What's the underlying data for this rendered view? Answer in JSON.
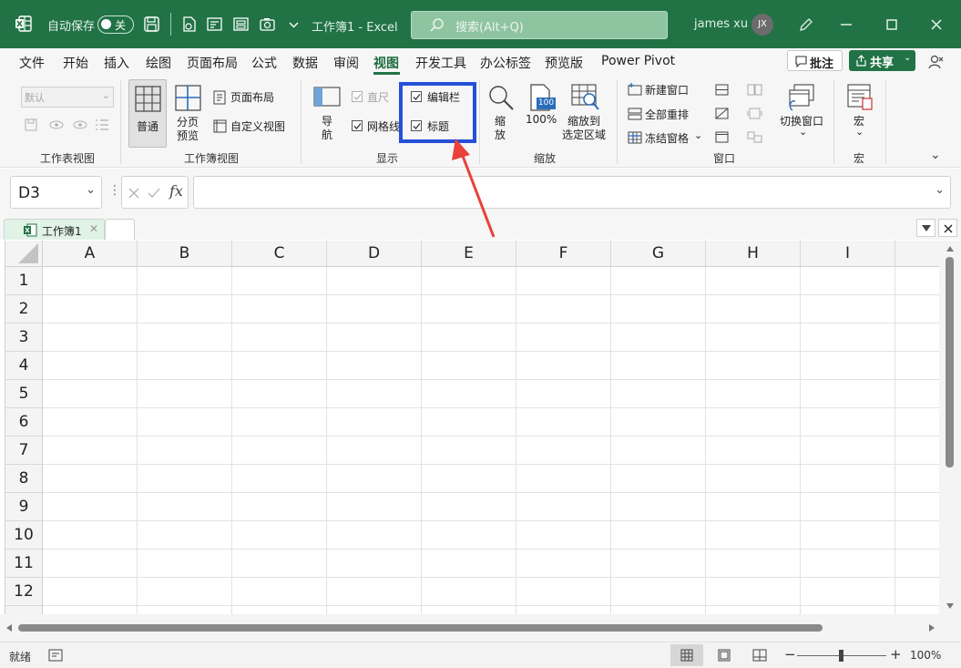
{
  "titlebar": {
    "autosave_label": "自动保存",
    "autosave_state": "关",
    "doc_title": "工作簿1  -  Excel",
    "search_placeholder": "搜索(Alt+Q)",
    "user_name": "james xu",
    "user_initials": "JX"
  },
  "menu": {
    "items": [
      "文件",
      "开始",
      "插入",
      "绘图",
      "页面布局",
      "公式",
      "数据",
      "审阅",
      "视图",
      "开发工具",
      "办公标签",
      "预览版",
      "Power Pivot"
    ],
    "active": "视图",
    "comments_label": "批注",
    "share_label": "共享"
  },
  "ribbon": {
    "sheet_view": {
      "dropdown_value": "默认",
      "group_label": "工作表视图"
    },
    "workbook_views": {
      "normal": "普通",
      "page_break_1": "分页",
      "page_break_2": "预览",
      "page_layout": "页面布局",
      "custom_views": "自定义视图",
      "group_label": "工作簿视图"
    },
    "show": {
      "navigation_1": "导",
      "navigation_2": "航",
      "ruler": "直尺",
      "gridlines": "网格线",
      "formula_bar": "编辑栏",
      "headings": "标题",
      "group_label": "显示"
    },
    "zoom": {
      "zoom_1": "缩",
      "zoom_2": "放",
      "hundred": "100%",
      "hundred_icon_text": "100",
      "zoom_to_selection_1": "缩放到",
      "zoom_to_selection_2": "选定区域",
      "group_label": "缩放"
    },
    "window": {
      "new_window": "新建窗口",
      "arrange_all": "全部重排",
      "freeze_panes": "冻结窗格",
      "switch_windows": "切换窗口",
      "group_label": "窗口"
    },
    "macros": {
      "macros": "宏",
      "group_label": "宏"
    }
  },
  "formula_bar": {
    "name_box": "D3",
    "fx": "fx",
    "value": ""
  },
  "sheet_tabs": {
    "active_tab": "工作簿1"
  },
  "grid": {
    "columns": [
      "A",
      "B",
      "C",
      "D",
      "E",
      "F",
      "G",
      "H",
      "I"
    ],
    "rows": [
      "1",
      "2",
      "3",
      "4",
      "5",
      "6",
      "7",
      "8",
      "9",
      "10",
      "11",
      "12"
    ]
  },
  "status": {
    "ready": "就绪",
    "zoom": "100%"
  },
  "colors": {
    "brand": "#217346",
    "highlight": "#2450d8",
    "arrow": "#e8423b"
  }
}
